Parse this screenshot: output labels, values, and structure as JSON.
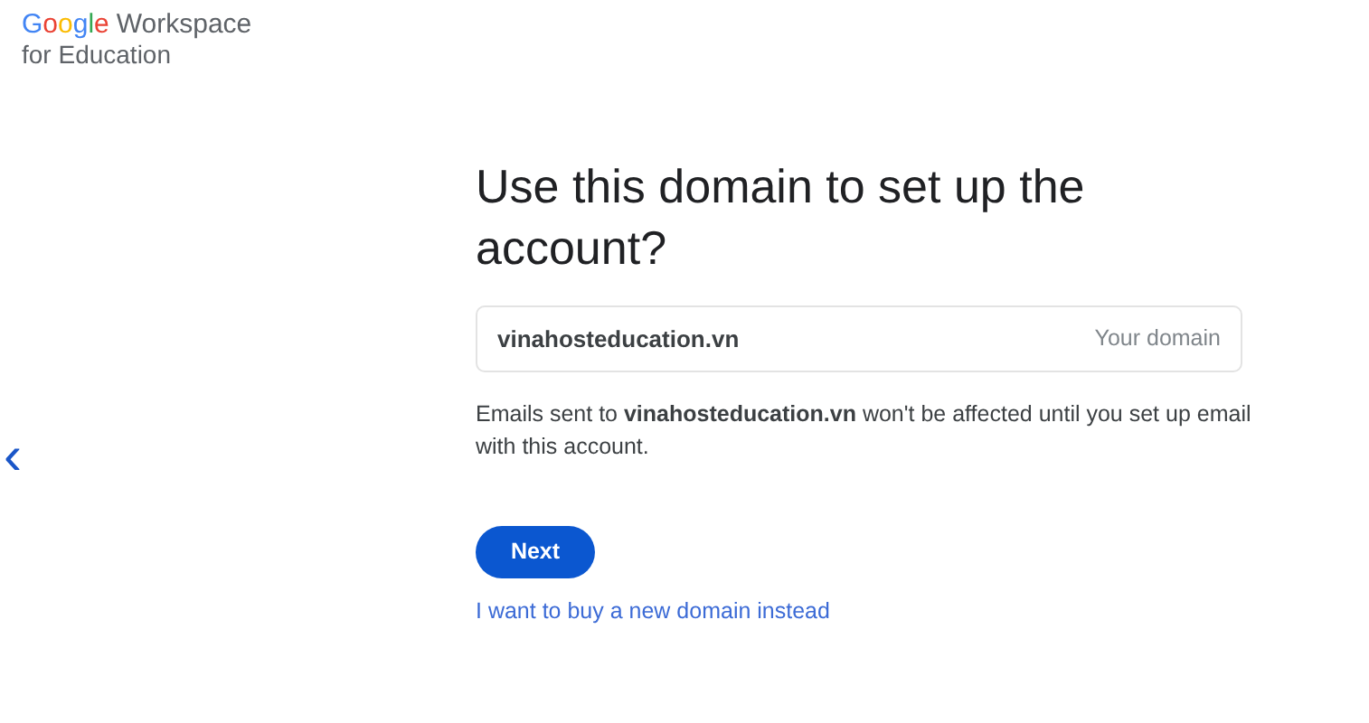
{
  "logo": {
    "brand": "Google",
    "product": "Workspace",
    "subtitle": "for Education"
  },
  "back_button": {
    "label": "‹"
  },
  "heading": "Use this domain to set up the account?",
  "domain_field": {
    "value": "vinahosteducation.vn",
    "label": "Your domain"
  },
  "note": "Emails sent to **vinahosteducation.vn** won't be affected until you set up email with this account.",
  "next_button": {
    "label": "Next"
  },
  "alt_link": {
    "label": "I want to buy a new domain instead"
  }
}
